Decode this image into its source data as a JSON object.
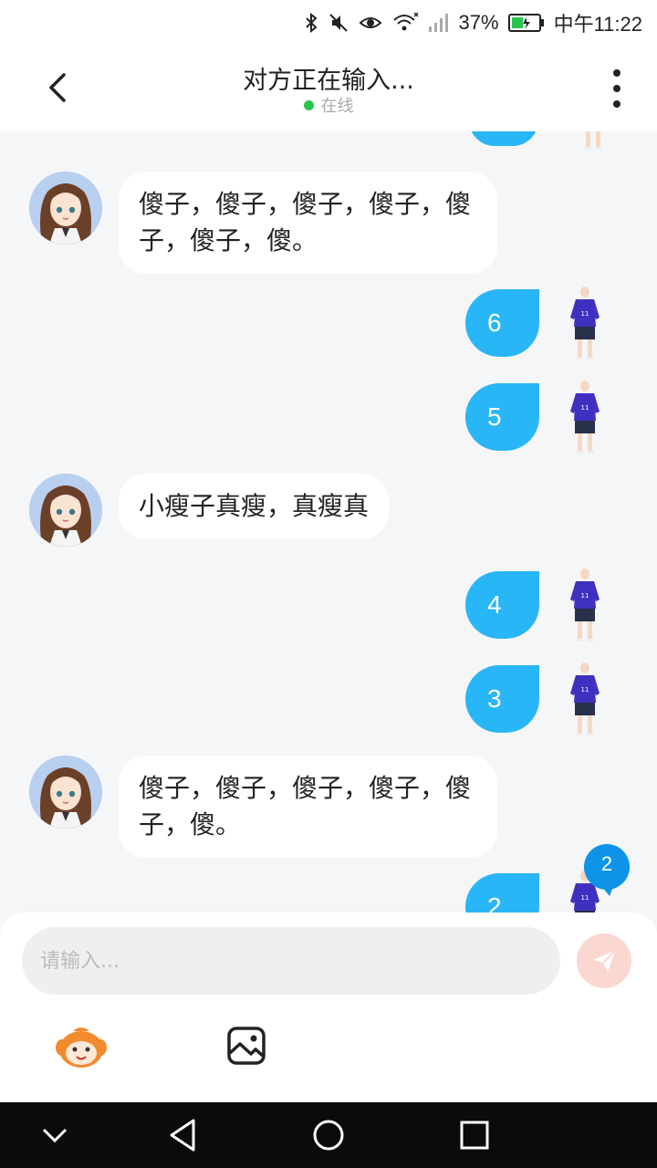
{
  "status_bar": {
    "battery": "37%",
    "time": "中午11:22"
  },
  "header": {
    "title": "对方正在输入...",
    "status": "在线"
  },
  "messages": [
    {
      "side": "left",
      "text": "傻子，傻子，傻子，傻子，傻子，傻子，傻。"
    },
    {
      "side": "right",
      "text": "6"
    },
    {
      "side": "right",
      "text": "5"
    },
    {
      "side": "left",
      "text": "小瘦子真瘦，真瘦真"
    },
    {
      "side": "right",
      "text": "4"
    },
    {
      "side": "right",
      "text": "3"
    },
    {
      "side": "left",
      "text": "傻子，傻子，傻子，傻子，傻子，傻。"
    },
    {
      "side": "right",
      "text": "2"
    }
  ],
  "unread_badge": "2",
  "composer": {
    "placeholder": "请输入..."
  },
  "colors": {
    "accent": "#29b6f6",
    "online": "#2bc451",
    "send_disabled": "#fbd7d2"
  },
  "icons": [
    "back-arrow-icon",
    "more-vertical-icon",
    "send-icon",
    "emoji-icon",
    "image-icon",
    "nav-back-icon",
    "nav-home-icon",
    "nav-recents-icon"
  ]
}
